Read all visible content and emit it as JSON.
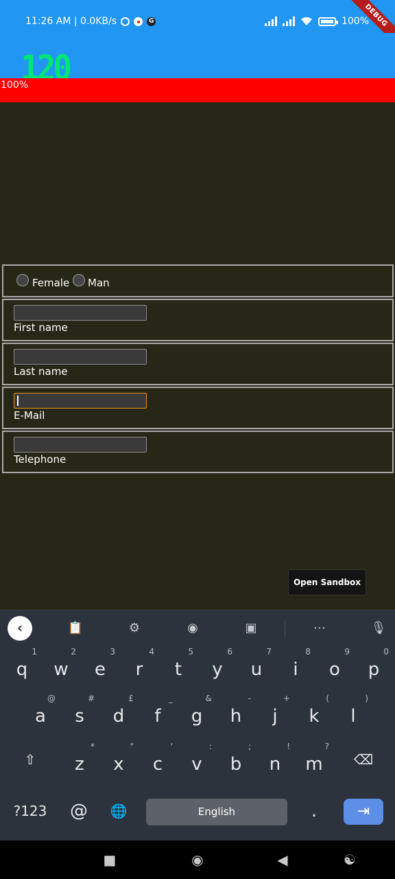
{
  "status_bar": {
    "time": "11:26 AM | 0.0KB/s",
    "battery": "100%",
    "debug_banner": "DEBUG"
  },
  "app": {
    "fps": "120",
    "progress_label": "100%",
    "progress_value": 1.0,
    "progress_color": "#ff0000",
    "app_bar_color": "#2196f3"
  },
  "form": {
    "gender_options": [
      "Female",
      "Man"
    ],
    "fields": [
      {
        "label": "First name",
        "value": "",
        "focused": false
      },
      {
        "label": "Last name",
        "value": "",
        "focused": false
      },
      {
        "label": "E-Mail",
        "value": "",
        "focused": true
      },
      {
        "label": "Telephone",
        "value": "",
        "focused": false
      }
    ],
    "sandbox_button": "Open Sandbox"
  },
  "keyboard": {
    "toolbar_icons": [
      "back-icon",
      "clipboard-icon",
      "settings-icon",
      "palette-icon",
      "floating-keyboard-icon",
      "more-icon",
      "mic-off-icon"
    ],
    "row1": [
      {
        "key": "q",
        "hint": "1"
      },
      {
        "key": "w",
        "hint": "2"
      },
      {
        "key": "e",
        "hint": "3"
      },
      {
        "key": "r",
        "hint": "4"
      },
      {
        "key": "t",
        "hint": "5"
      },
      {
        "key": "y",
        "hint": "6"
      },
      {
        "key": "u",
        "hint": "7"
      },
      {
        "key": "i",
        "hint": "8"
      },
      {
        "key": "o",
        "hint": "9"
      },
      {
        "key": "p",
        "hint": "0"
      }
    ],
    "row2": [
      {
        "key": "a",
        "hint": "@"
      },
      {
        "key": "s",
        "hint": "#"
      },
      {
        "key": "d",
        "hint": "£"
      },
      {
        "key": "f",
        "hint": "_"
      },
      {
        "key": "g",
        "hint": "&"
      },
      {
        "key": "h",
        "hint": "-"
      },
      {
        "key": "j",
        "hint": "+"
      },
      {
        "key": "k",
        "hint": "("
      },
      {
        "key": "l",
        "hint": ")"
      }
    ],
    "row3": [
      {
        "key": "z",
        "hint": "*"
      },
      {
        "key": "x",
        "hint": "\""
      },
      {
        "key": "c",
        "hint": "'"
      },
      {
        "key": "v",
        "hint": ":"
      },
      {
        "key": "b",
        "hint": ";"
      },
      {
        "key": "n",
        "hint": "!"
      },
      {
        "key": "m",
        "hint": "?"
      }
    ],
    "symbols_key": "?123",
    "at_key": "@",
    "space_label": "English",
    "period_key": "."
  }
}
